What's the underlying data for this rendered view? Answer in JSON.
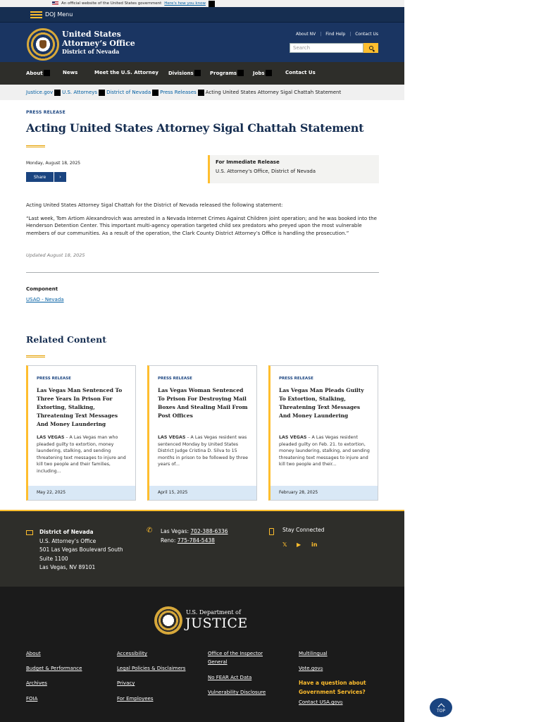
{
  "gov_banner": {
    "text": "An official website of the United States government",
    "link": "Here's how you know"
  },
  "doj_menu": {
    "label": "DOJ Menu"
  },
  "header": {
    "title_line1": "United States",
    "title_line2": "Attorney’s Office",
    "title_line3": "District of Nevada",
    "utility": [
      "About NV",
      "Find Help",
      "Contact Us"
    ],
    "search_placeholder": "Search"
  },
  "nav": {
    "items": [
      {
        "label": "About"
      },
      {
        "label": "News"
      },
      {
        "label": "Meet the U.S. Attorney"
      },
      {
        "label": "Divisions"
      },
      {
        "label": "Programs"
      },
      {
        "label": "Jobs"
      },
      {
        "label": "Contact Us"
      }
    ]
  },
  "breadcrumb": {
    "items": [
      "Justice.gov",
      "U.S. Attorneys",
      "District of Nevada",
      "Press Releases"
    ],
    "current": "Acting United States Attorney Sigal Chattah Statement"
  },
  "article": {
    "eyebrow": "PRESS RELEASE",
    "title": "Acting United States Attorney Sigal Chattah Statement",
    "date": "Monday, August 18, 2025",
    "share_label": "Share",
    "share_arrow": "›",
    "release_title": "For Immediate Release",
    "release_office": "U.S. Attorney's Office, District of Nevada",
    "paragraph1": "Acting United States Attorney Sigal Chattah for the District of Nevada released the following statement:",
    "paragraph2": "“Last week, Tom Artiom Alexandrovich was arrested in a Nevada Internet Crimes Against Children joint operation; and he was booked into the Henderson Detention Center. This important multi-agency operation targeted child sex predators who preyed upon the most vulnerable members of our communities. As a result of the operation, the Clark County District Attorney’s Office is handling the prosecution.”",
    "updated": "Updated August 18, 2025",
    "component_label": "Component",
    "component_link": "USAO - Nevada"
  },
  "related": {
    "title": "Related Content",
    "cards": [
      {
        "eyebrow": "PRESS RELEASE",
        "title": "Las Vegas Man Sentenced To Three Years In Prison For Extorting, Stalking, Threatening Text Messages And Money Laundering",
        "dateline": "LAS VEGAS",
        "summary": " – A Las Vegas man who pleaded guilty to extortion, money laundering, stalking, and sending threatening text messages to injure and kill two people and their families, including...",
        "date": "May 22, 2025"
      },
      {
        "eyebrow": "PRESS RELEASE",
        "title": "Las Vegas Woman Sentenced To Prison For Destroying Mail Boxes And Stealing Mail From Post Offices",
        "dateline": "LAS VEGAS",
        "summary": " – A Las Vegas resident was sentenced Monday by United States District Judge Cristina D. Silva to 15 months in prison to be followed by three years of...",
        "date": "April 15, 2025"
      },
      {
        "eyebrow": "PRESS RELEASE",
        "title": "Las Vegas Man Pleads Guilty To Extortion, Stalking, Threatening Text Messages And Money Laundering",
        "dateline": "LAS VEGAS",
        "summary": " – A Las Vegas resident pleaded guilty on Feb. 21. to extortion, money laundering, stalking, and sending threatening text messages to injure and kill two people and their...",
        "date": "February 28, 2025"
      }
    ]
  },
  "contact": {
    "district": "District of Nevada",
    "office": "U.S. Attorney’s Office",
    "street": "501 Las Vegas Boulevard South",
    "suite": "Suite 1100",
    "city": "Las Vegas, NV 89101",
    "phone1_label": "Las Vegas: ",
    "phone1": "702-388-6336",
    "phone2_label": "Reno: ",
    "phone2": "775-784-5438",
    "stay_connected": "Stay Connected",
    "social_icons": [
      "x-icon",
      "youtube-icon",
      "linkedin-icon"
    ]
  },
  "footer": {
    "dept_small": "U.S. Department of",
    "dept_big": "JUSTICE",
    "col1": [
      "About",
      "Budget & Performance",
      "Archives",
      "FOIA"
    ],
    "col2": [
      "Accessibility",
      "Legal Policies & Disclaimers",
      "Privacy",
      "For Employees"
    ],
    "col3": [
      "Office of the Inspector General",
      "No FEAR Act Data",
      "Vulnerability Disclosure"
    ],
    "col4": [
      "Multilingual",
      "Vote.gov"
    ],
    "question": "Have a question about Government Services?",
    "contact_usa": "Contact USA.gov",
    "top": "TOP"
  },
  "colors": {
    "navy": "#162e51",
    "header_blue": "#1a3562",
    "gold": "#ffbe2e",
    "link_blue": "#005ea2",
    "nav_dark": "#2e2e2a"
  }
}
